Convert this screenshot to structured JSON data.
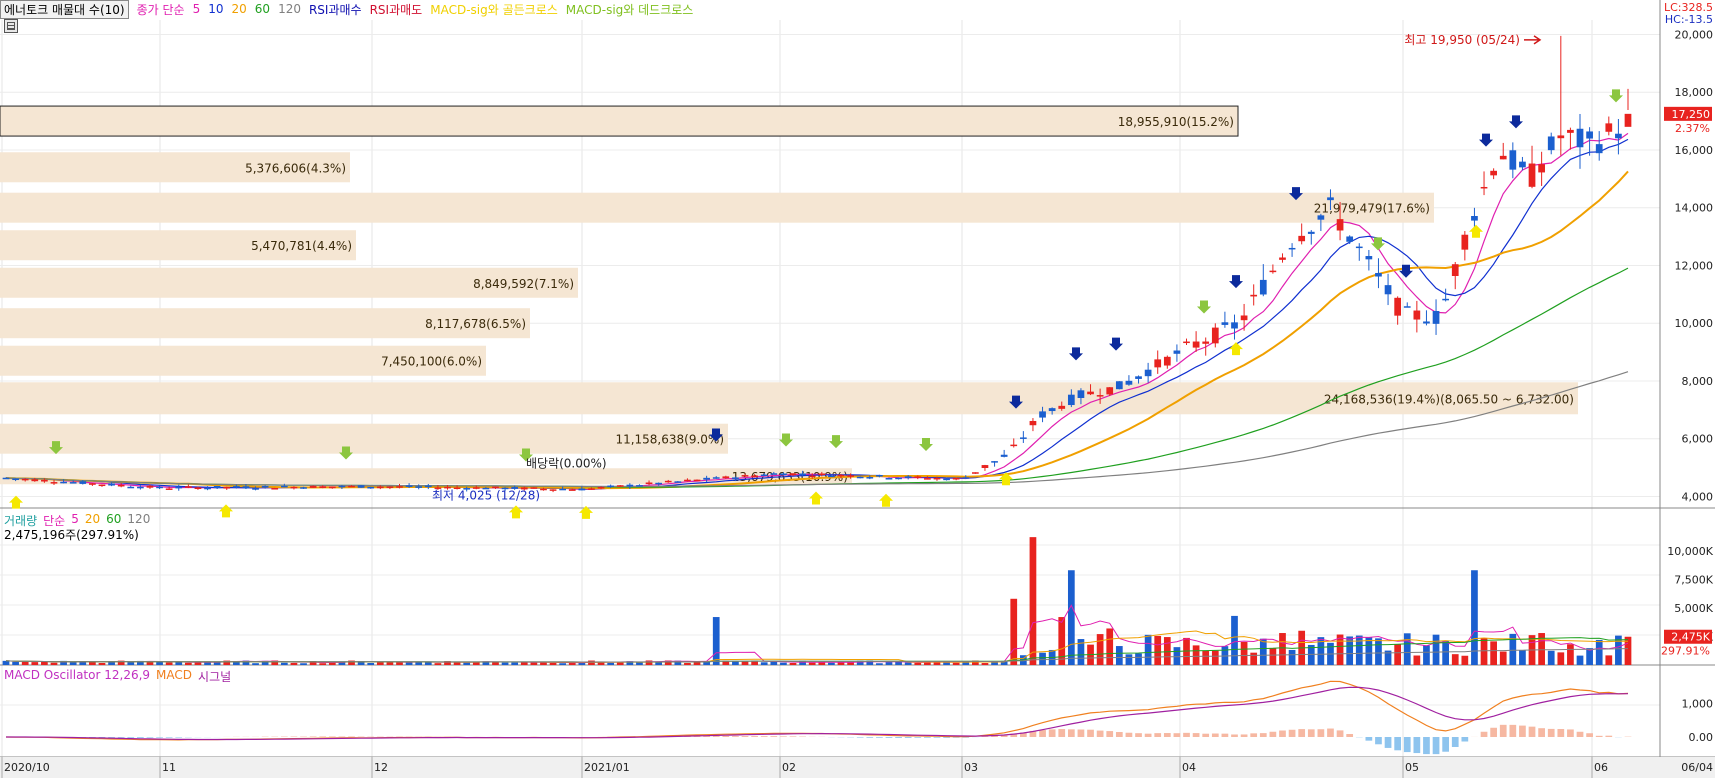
{
  "header": {
    "title": "에너토크 매물대 수(10)",
    "ma_label": "종가 단순",
    "ma_periods": [
      "5",
      "10",
      "20",
      "60",
      "120"
    ],
    "ma_colors": [
      "#e020b0",
      "#1030d0",
      "#f0a000",
      "#20a020",
      "#808080"
    ],
    "rsi_buy": "RSI과매수",
    "rsi_sell": "RSI과매도",
    "macd_golden": "MACD-sig와 골든크로스",
    "macd_dead": "MACD-sig와 데드크로스"
  },
  "corner": {
    "lc": "LC:328.5",
    "hc": "HC:-13.5"
  },
  "price_panel": {
    "y_ticks": [
      "4,000",
      "6,000",
      "8,000",
      "10,000",
      "12,000",
      "14,000",
      "16,000",
      "18,000",
      "20,000"
    ],
    "current_price": "17,250",
    "current_change": "2.37%",
    "high_label": "최고 19,950 (05/24)",
    "low_label": "최저 4,025 (12/28)",
    "dividend_label": "배당락(0.00%)",
    "volume_profile": [
      {
        "label": "18,955,910(15.2%)",
        "level": 17000
      },
      {
        "label": "21,979,479(17.6%)",
        "level": 14000
      },
      {
        "label": "24,168,536(19.4%)(8,065.50 ~ 6,732.00)",
        "level": 7400
      },
      {
        "label": "13,679,633(10.9%)",
        "level": 4700
      },
      {
        "label": "11,158,638(9.0%)",
        "level": 6000
      },
      {
        "label": "7,450,100(6.0%)",
        "level": 8700
      },
      {
        "label": "8,117,678(6.5%)",
        "level": 10000
      },
      {
        "label": "8,849,592(7.1%)",
        "level": 11400
      },
      {
        "label": "5,470,781(4.4%)",
        "level": 12700
      },
      {
        "label": "5,376,606(4.3%)",
        "level": 15400
      }
    ]
  },
  "volume_panel": {
    "title": "거래량",
    "ma_label": "단순",
    "ma_periods": [
      "5",
      "20",
      "60",
      "120"
    ],
    "current_label": "2,475,196주(297.91%)",
    "current_badge": "2,475K",
    "current_pct": "297.91%",
    "y_ticks": [
      "2,500K",
      "5,000K",
      "7,500K",
      "10,000K"
    ]
  },
  "macd_panel": {
    "title": "MACD Oscillator 12,26,9",
    "macd_label": "MACD",
    "signal_label": "시그널",
    "y_ticks": [
      "0.00",
      "1,000"
    ]
  },
  "x_axis": {
    "labels": [
      "2020/10",
      "11",
      "12",
      "2021/01",
      "02",
      "03",
      "04",
      "05",
      "06"
    ],
    "end_label": "06/04"
  },
  "chart_data": {
    "type": "candlestick",
    "period": "2020/10 ~ 06/04",
    "price_range": [
      3600,
      20500
    ],
    "monthly_close_estimates": [
      {
        "month": "2020/10",
        "close": 4300
      },
      {
        "month": "11",
        "close": 4350
      },
      {
        "month": "12",
        "close": 4200
      },
      {
        "month": "2021/01",
        "close": 4600
      },
      {
        "month": "02",
        "close": 4800
      },
      {
        "month": "03",
        "close": 7500
      },
      {
        "month": "04",
        "close": 12500
      },
      {
        "month": "05",
        "close": 16000
      },
      {
        "month": "06",
        "close": 17250
      }
    ],
    "high": 19950,
    "low": 4025
  }
}
